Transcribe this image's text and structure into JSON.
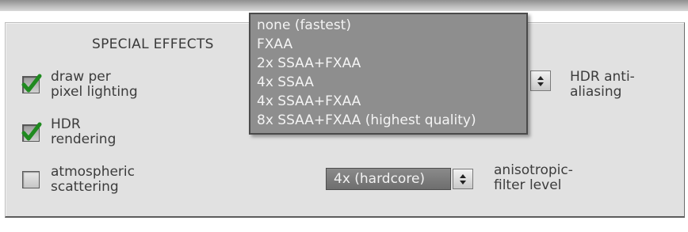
{
  "section": {
    "title": "SPECIAL EFFECTS"
  },
  "options": {
    "per_pixel_lighting": {
      "label": "draw per\npixel lighting",
      "checked": true
    },
    "hdr_rendering": {
      "label": "HDR\nrendering",
      "checked": true
    },
    "atmospheric_scattering": {
      "label": "atmospheric\nscattering",
      "checked": false
    }
  },
  "hdr_antialiasing": {
    "label": "HDR anti-\naliasing",
    "dropdown_options": [
      "none (fastest)",
      "FXAA",
      "2x SSAA+FXAA",
      "4x SSAA",
      "4x SSAA+FXAA",
      "8x SSAA+FXAA (highest quality)"
    ]
  },
  "anisotropic": {
    "label": "anisotropic-\nfilter level",
    "value": "4x (hardcore)"
  },
  "colors": {
    "panel": "#e1e1e1",
    "checkmark": "#1f8a1f",
    "dropdown_bg": "#8e8e8e"
  },
  "icons": [
    "check-icon",
    "spinner-up-icon",
    "spinner-down-icon"
  ]
}
